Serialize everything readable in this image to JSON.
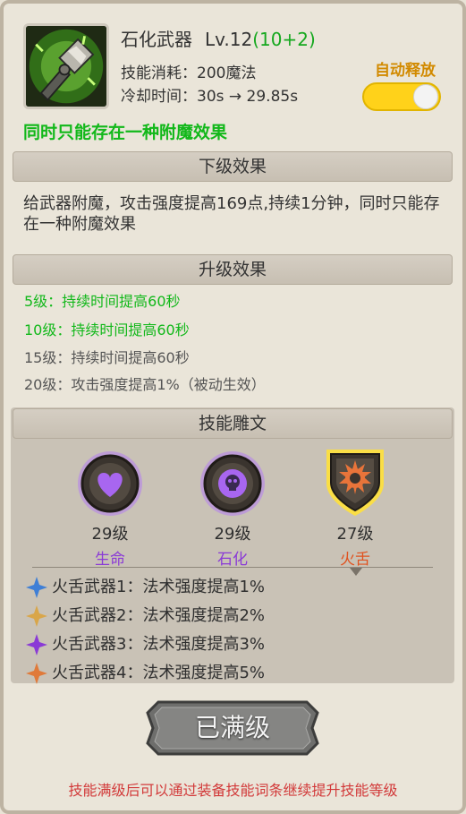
{
  "skill": {
    "name": "石化武器",
    "level": "Lv.12",
    "bonus": "(10+2)",
    "cost": "技能消耗：200魔法",
    "cooldown": "冷却时间：30s → 29.85s",
    "auto_label": "自动释放",
    "auto_enabled": true,
    "note": "同时只能存在一种附魔效果"
  },
  "next_level": {
    "header": "下级效果",
    "description": "给武器附魔，攻击强度提高169点,持续1分钟，同时只能存在一种附魔效果"
  },
  "upgrades": {
    "header": "升级效果",
    "items": [
      {
        "text": "5级：持续时间提高60秒",
        "unlocked": true
      },
      {
        "text": "10级：持续时间提高60秒",
        "unlocked": true
      },
      {
        "text": "15级：持续时间提高60秒",
        "unlocked": false
      },
      {
        "text": "20级：攻击强度提高1%（被动生效）",
        "unlocked": false
      }
    ]
  },
  "carving": {
    "header": "技能雕文",
    "runes": [
      {
        "level": "29级",
        "name": "生命",
        "name_color": "#8a3ad6",
        "icon": "heart-rune-icon"
      },
      {
        "level": "29级",
        "name": "石化",
        "name_color": "#8a3ad6",
        "icon": "skull-rune-icon"
      },
      {
        "level": "27级",
        "name": "火舌",
        "name_color": "#e0521f",
        "icon": "fire-rune-icon",
        "selected": true
      }
    ],
    "effects": [
      {
        "text": "火舌武器1：法术强度提高1%",
        "star_color": "#3f7fd6"
      },
      {
        "text": "火舌武器2：法术强度提高2%",
        "star_color": "#d9a64a"
      },
      {
        "text": "火舌武器3：法术强度提高3%",
        "star_color": "#8a3ad6"
      },
      {
        "text": "火舌武器4：法术强度提高5%",
        "star_color": "#e07a3a"
      }
    ]
  },
  "max_button": {
    "label": "已满级"
  },
  "footer_note": "技能满级后可以通过装备技能词条继续提升技能等级"
}
